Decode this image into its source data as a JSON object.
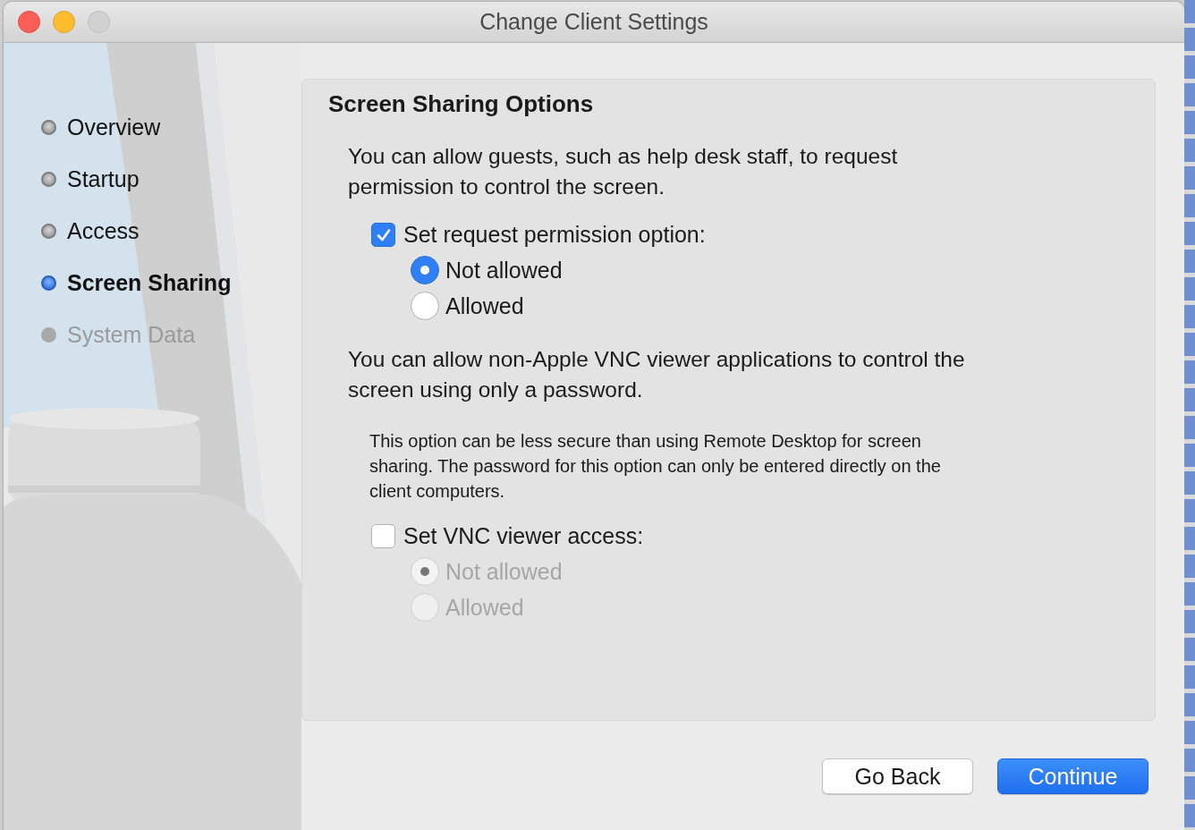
{
  "window": {
    "title": "Change Client Settings"
  },
  "steps": [
    {
      "label": "Overview",
      "selected": false,
      "disabled": false
    },
    {
      "label": "Startup",
      "selected": false,
      "disabled": false
    },
    {
      "label": "Access",
      "selected": false,
      "disabled": false
    },
    {
      "label": "Screen Sharing",
      "selected": true,
      "disabled": false
    },
    {
      "label": "System Data",
      "selected": false,
      "disabled": true
    }
  ],
  "section": {
    "title": "Screen Sharing Options",
    "groups": [
      {
        "description": "You can allow guests, such as help desk staff, to request permission to control the screen.",
        "checkbox": {
          "label": "Set request permission option:",
          "checked": true
        },
        "options": [
          {
            "label": "Not allowed",
            "selected": true,
            "disabled": false
          },
          {
            "label": "Allowed",
            "selected": false,
            "disabled": false
          }
        ]
      },
      {
        "description": "You can allow non-Apple VNC viewer applications to control the screen using only a password.",
        "note": "This option can be less secure than using Remote Desktop for screen sharing.  The password for this option can only be entered directly on the client computers.",
        "checkbox": {
          "label": "Set VNC viewer access:",
          "checked": false
        },
        "options": [
          {
            "label": "Not allowed",
            "selected": true,
            "disabled": true
          },
          {
            "label": "Allowed",
            "selected": false,
            "disabled": true
          }
        ]
      }
    ]
  },
  "buttons": [
    {
      "label": "Go Back",
      "kind": "secondary"
    },
    {
      "label": "Continue",
      "kind": "primary"
    }
  ]
}
